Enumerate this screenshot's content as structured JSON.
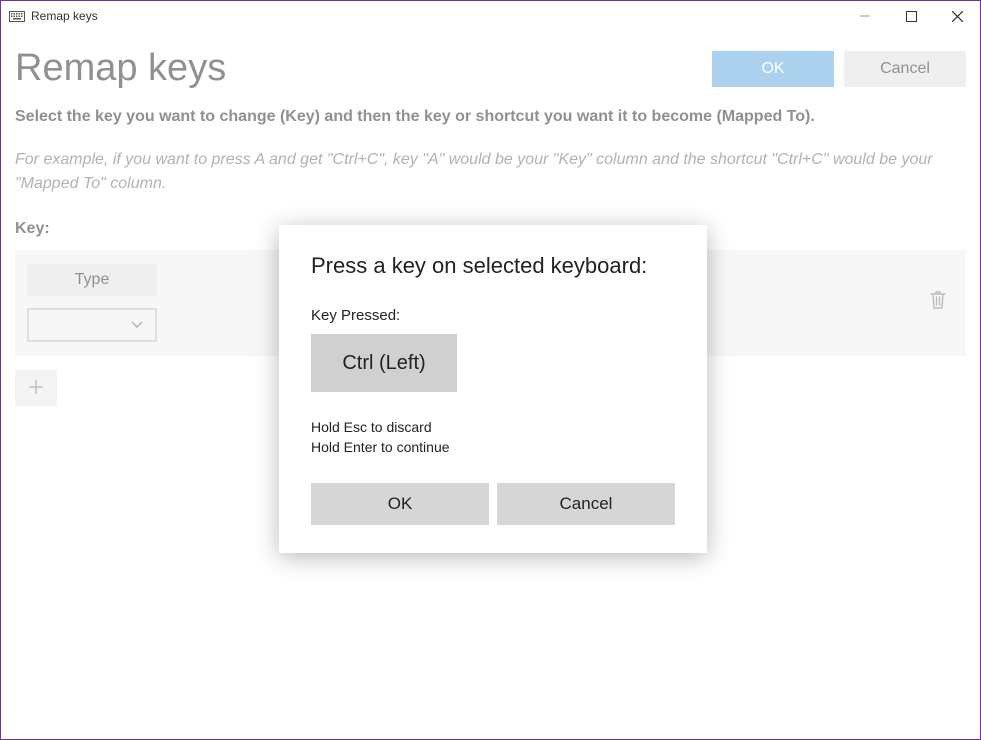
{
  "titlebar": {
    "title": "Remap keys"
  },
  "heading": "Remap keys",
  "buttons": {
    "ok": "OK",
    "cancel": "Cancel"
  },
  "description": {
    "line1": "Select the key you want to change (Key) and then the key or shortcut you want it to become (Mapped To).",
    "line2": "For example, if you want to press A and get \"Ctrl+C\", key \"A\" would be your \"Key\" column and the shortcut \"Ctrl+C\" would be your \"Mapped To\" column."
  },
  "labels": {
    "key": "Key:",
    "type": "Type"
  },
  "dialog": {
    "title": "Press a key on selected keyboard:",
    "keypressed_label": "Key Pressed:",
    "keypressed_value": "Ctrl (Left)",
    "hint1": "Hold Esc to discard",
    "hint2": "Hold Enter to continue",
    "ok": "OK",
    "cancel": "Cancel"
  }
}
